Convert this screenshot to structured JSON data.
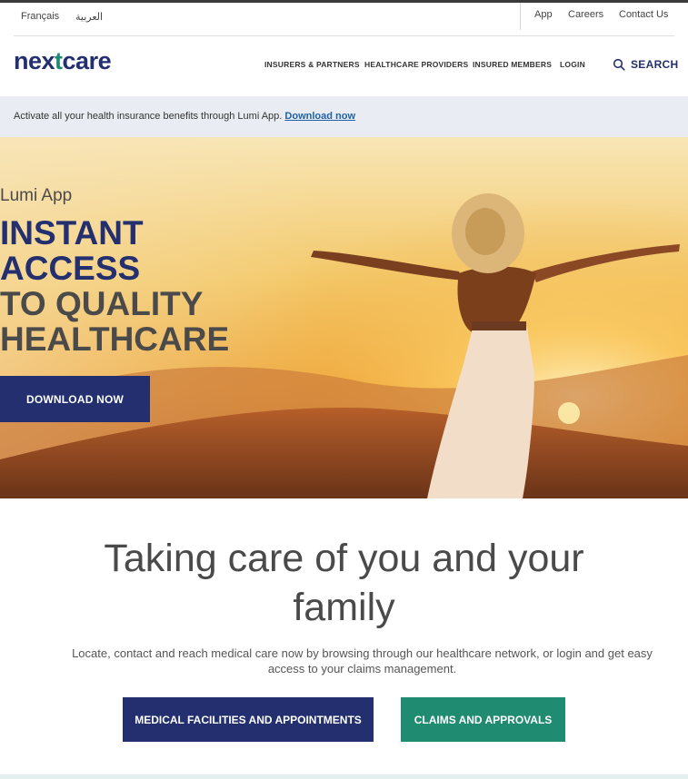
{
  "utility": {
    "languages": [
      "Français",
      "العربية"
    ],
    "links": [
      "App",
      "Careers",
      "Contact Us"
    ]
  },
  "header": {
    "logo": {
      "part1": "nex",
      "accent": "t",
      "part2": "care"
    },
    "nav": [
      "INSURERS & PARTNERS",
      "HEALTHCARE PROVIDERS",
      "INSURED MEMBERS",
      "LOGIN"
    ],
    "search_label": "SEARCH"
  },
  "banner": {
    "text": "Activate all your health insurance benefits through Lumi App.",
    "link": "Download now"
  },
  "hero": {
    "eyebrow": "Lumi App",
    "title_lines": [
      "INSTANT",
      "ACCESS",
      "TO QUALITY",
      "HEALTHCARE"
    ],
    "cta": "DOWNLOAD NOW"
  },
  "intro": {
    "title_line1": "Taking care of you and your",
    "title_line2": "family",
    "text": "Locate, contact and reach medical care now by browsing through our healthcare network, or login and get easy access to your claims management.",
    "primary_button": "MEDICAL FACILITIES AND APPOINTMENTS",
    "secondary_button": "CLAIMS AND APPROVALS"
  },
  "colors": {
    "brand_navy": "#232f6e",
    "brand_green": "#1f8b70",
    "banner_bg": "#e9ecf2",
    "link_blue": "#1f62a8"
  },
  "icons": {
    "search": "search-icon"
  }
}
